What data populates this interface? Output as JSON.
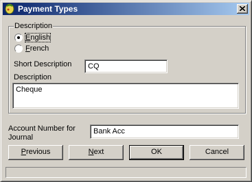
{
  "window": {
    "title": "Payment Types",
    "icon": "app-icon",
    "close_icon": "close-icon"
  },
  "description_group": {
    "legend": "Description",
    "options": [
      {
        "label": "English",
        "selected": true
      },
      {
        "label": "French",
        "selected": false
      }
    ]
  },
  "short_description": {
    "label": "Short Description",
    "value": "CQ"
  },
  "description": {
    "label": "Description",
    "value": "Cheque"
  },
  "account_number": {
    "label_line1": "Account Number for",
    "label_line2": "Journal",
    "value": "Bank Acc"
  },
  "buttons": {
    "previous": "Previous",
    "next": "Next",
    "ok": "OK",
    "cancel": "Cancel"
  },
  "status": {
    "text": ""
  }
}
